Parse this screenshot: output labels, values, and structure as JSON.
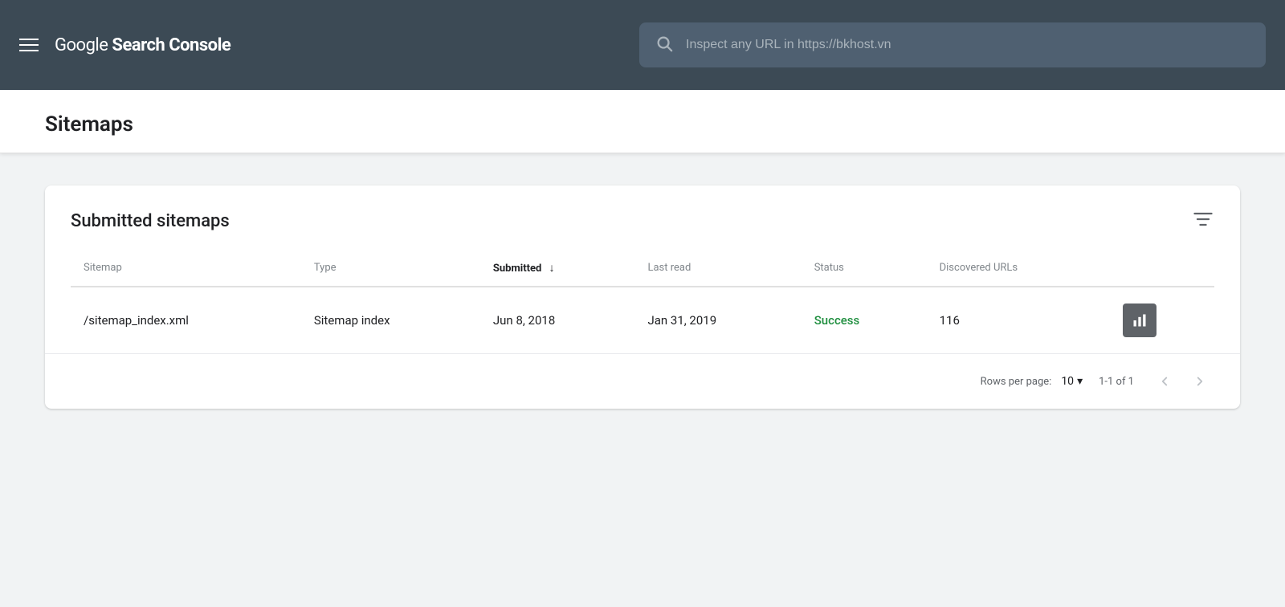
{
  "header": {
    "menu_icon_label": "menu",
    "logo": {
      "prefix": "Google ",
      "suffix": "Search Console"
    },
    "search": {
      "placeholder_static": "Inspect any URL in ",
      "placeholder_url": "https://bkhost.vn"
    }
  },
  "page": {
    "title": "Sitemaps"
  },
  "card": {
    "title": "Submitted sitemaps",
    "filter_icon_label": "filter",
    "table": {
      "columns": [
        {
          "id": "sitemap",
          "label": "Sitemap",
          "sorted": false
        },
        {
          "id": "type",
          "label": "Type",
          "sorted": false
        },
        {
          "id": "submitted",
          "label": "Submitted",
          "sorted": true
        },
        {
          "id": "last_read",
          "label": "Last read",
          "sorted": false
        },
        {
          "id": "status",
          "label": "Status",
          "sorted": false
        },
        {
          "id": "discovered_urls",
          "label": "Discovered URLs",
          "sorted": false
        }
      ],
      "rows": [
        {
          "sitemap": "/sitemap_index.xml",
          "type": "Sitemap index",
          "submitted": "Jun 8, 2018",
          "last_read": "Jan 31, 2019",
          "status": "Success",
          "status_color": "#1e8e3e",
          "discovered_urls": "116",
          "has_chart": true
        }
      ]
    },
    "pagination": {
      "rows_per_page_label": "Rows per page:",
      "rows_per_page_value": "10",
      "page_info": "1-1 of 1"
    }
  }
}
